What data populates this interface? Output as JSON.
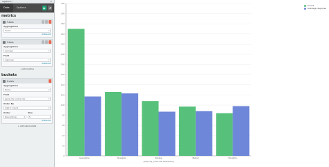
{
  "window": {
    "index_label": "logstash-*",
    "close_symbol": "×"
  },
  "tabs": [
    {
      "label": "Data",
      "active": true
    },
    {
      "label": "Options",
      "active": false
    }
  ],
  "tab_actions": {
    "apply_symbol": "▶",
    "discard_symbol": "↺"
  },
  "metrics": {
    "title": "metrics",
    "y_axis_1": {
      "label": "Y-Axis",
      "aggregation_label": "Aggregation",
      "aggregation_value": "Count",
      "advanced_link": "Advanced"
    },
    "y_axis_2": {
      "label": "Y-Axis",
      "aggregation_label": "Aggregation",
      "aggregation_value": "Average",
      "field_label": "Field",
      "field_value": "response",
      "advanced_link": "Advanced"
    },
    "add_button": "+ Add metrics"
  },
  "buckets": {
    "title": "buckets",
    "x_axis": {
      "label": "X-Axis",
      "aggregation_label": "Aggregation",
      "aggregation_value": "Terms",
      "field_label": "Field",
      "field_value": "geoip.city_name.raw",
      "order_by_label": "Order By",
      "order_by_value": "metric: Count",
      "order_label": "Order",
      "order_value": "Descending",
      "size_label": "Size",
      "size_value": "5",
      "advanced_link": "Advanced"
    },
    "add_button": "+ Add sub-buckets"
  },
  "legend": [
    {
      "label": "Count",
      "color": "#57c17b"
    },
    {
      "label": "Average response",
      "color": "#6f87d8"
    }
  ],
  "chart_data": {
    "type": "bar",
    "categories": [
      "Guangzhou",
      "Shanghai",
      "Nanjing",
      "Beijing",
      "Hangzhou"
    ],
    "series": [
      {
        "name": "Count",
        "color": "#57c17b",
        "values": [
          250,
          126,
          108,
          97,
          84
        ]
      },
      {
        "name": "Average response",
        "color": "#6f87d8",
        "values": [
          117,
          123,
          87,
          88,
          98
        ]
      }
    ],
    "xlabel": "geoip.city_name.raw: Descending",
    "ylim": [
      0,
      300
    ],
    "yticks": [
      0,
      20,
      40,
      60,
      80,
      100,
      120,
      140,
      160,
      180,
      200,
      220,
      240,
      260,
      280,
      300
    ],
    "grid": true,
    "legend_position": "top-right"
  }
}
